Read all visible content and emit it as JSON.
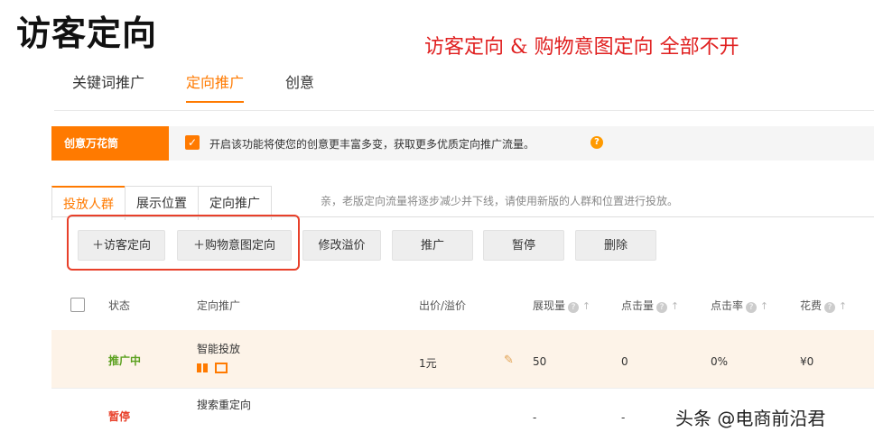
{
  "overlay": {
    "big_title": "访客定向",
    "red_note": "访客定向 & 购物意图定向 全部不开",
    "watermark": "头条 @电商前沿君"
  },
  "top_tabs": [
    {
      "label": "关键词推广",
      "active": false
    },
    {
      "label": "定向推广",
      "active": true
    },
    {
      "label": "创意",
      "active": false
    }
  ],
  "banner": {
    "label": "创意万花筒",
    "checked": true,
    "text": "开启该功能将使您的创意更丰富多变，获取更多优质定向推广流量。",
    "help_icon": "question-icon"
  },
  "sub_tabs": [
    {
      "label": "投放人群",
      "active": true
    },
    {
      "label": "展示位置",
      "active": false
    },
    {
      "label": "定向推广",
      "active": false
    }
  ],
  "sub_note": "亲，老版定向流量将逐步减少并下线，请使用新版的人群和位置进行投放。",
  "buttons": {
    "add_visitor": "＋访客定向",
    "add_intent": "＋购物意图定向",
    "modify_premium": "修改溢价",
    "promote": "推广",
    "pause": "暂停",
    "delete": "删除"
  },
  "table": {
    "headers": {
      "status": "状态",
      "targeting": "定向推广",
      "bid": "出价/溢价",
      "impressions": "展现量",
      "clicks": "点击量",
      "ctr": "点击率",
      "cost": "花费"
    },
    "rows": [
      {
        "status": "推广中",
        "name": "智能投放",
        "bid": "1元",
        "impressions": "50",
        "clicks": "0",
        "ctr": "0%",
        "cost": "¥0"
      },
      {
        "status": "暂停",
        "name": "搜索重定向",
        "bid": "",
        "impressions": "-",
        "clicks": "-",
        "ctr": "",
        "cost": ""
      }
    ]
  },
  "colors": {
    "accent": "#ff7a00",
    "highlight_box": "#e8402a",
    "status_on": "#5aa01e",
    "status_off": "#e8402a"
  }
}
